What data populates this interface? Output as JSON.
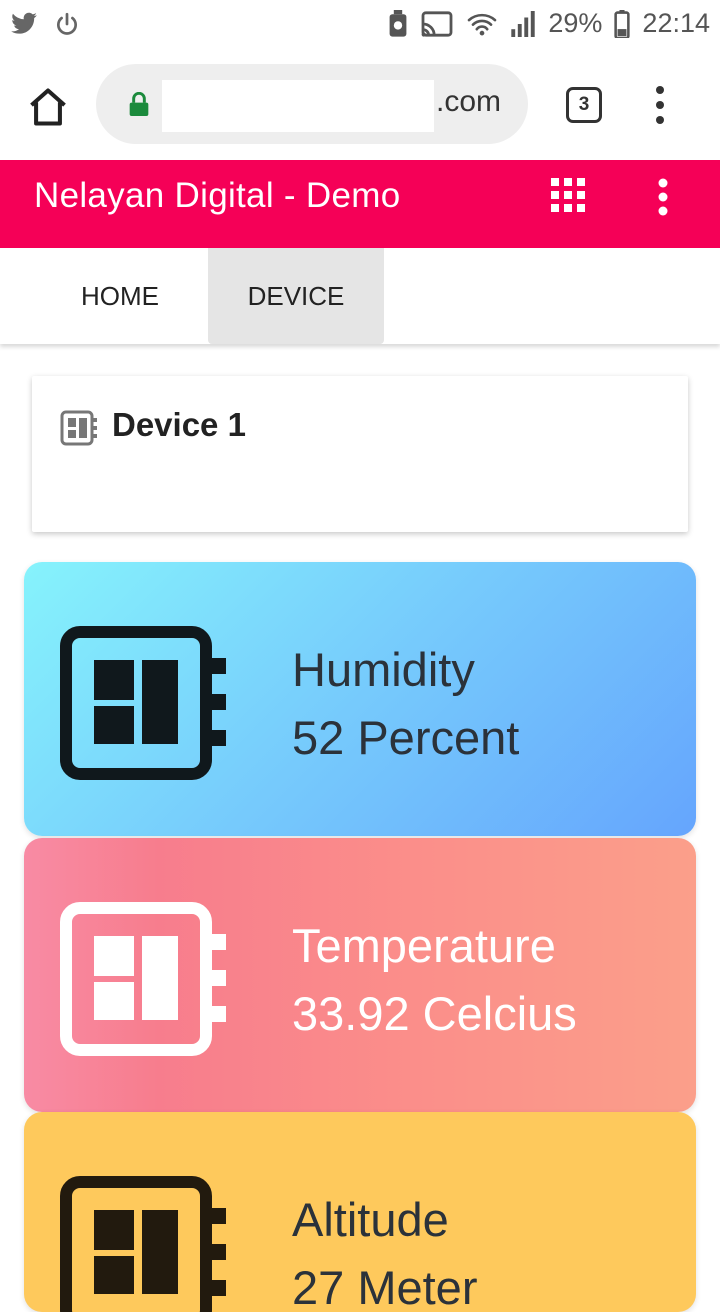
{
  "status_bar": {
    "battery_percent": "29%",
    "time": "22:14"
  },
  "browser": {
    "url_suffix": ".com",
    "tab_count": "3"
  },
  "app_bar": {
    "title": "Nelayan Digital - Demo",
    "color": "#f50057"
  },
  "nav": {
    "tabs": [
      {
        "label": "HOME",
        "active": false
      },
      {
        "label": "DEVICE",
        "active": true
      }
    ]
  },
  "device": {
    "title": "Device 1",
    "icon": "chip-icon"
  },
  "sensors": [
    {
      "label": "Humidity",
      "value": "52 Percent",
      "icon": "chip-icon"
    },
    {
      "label": "Temperature",
      "value": "33.92 Celcius",
      "icon": "chip-icon"
    },
    {
      "label": "Altitude",
      "value": "27 Meter",
      "icon": "chip-icon"
    }
  ]
}
